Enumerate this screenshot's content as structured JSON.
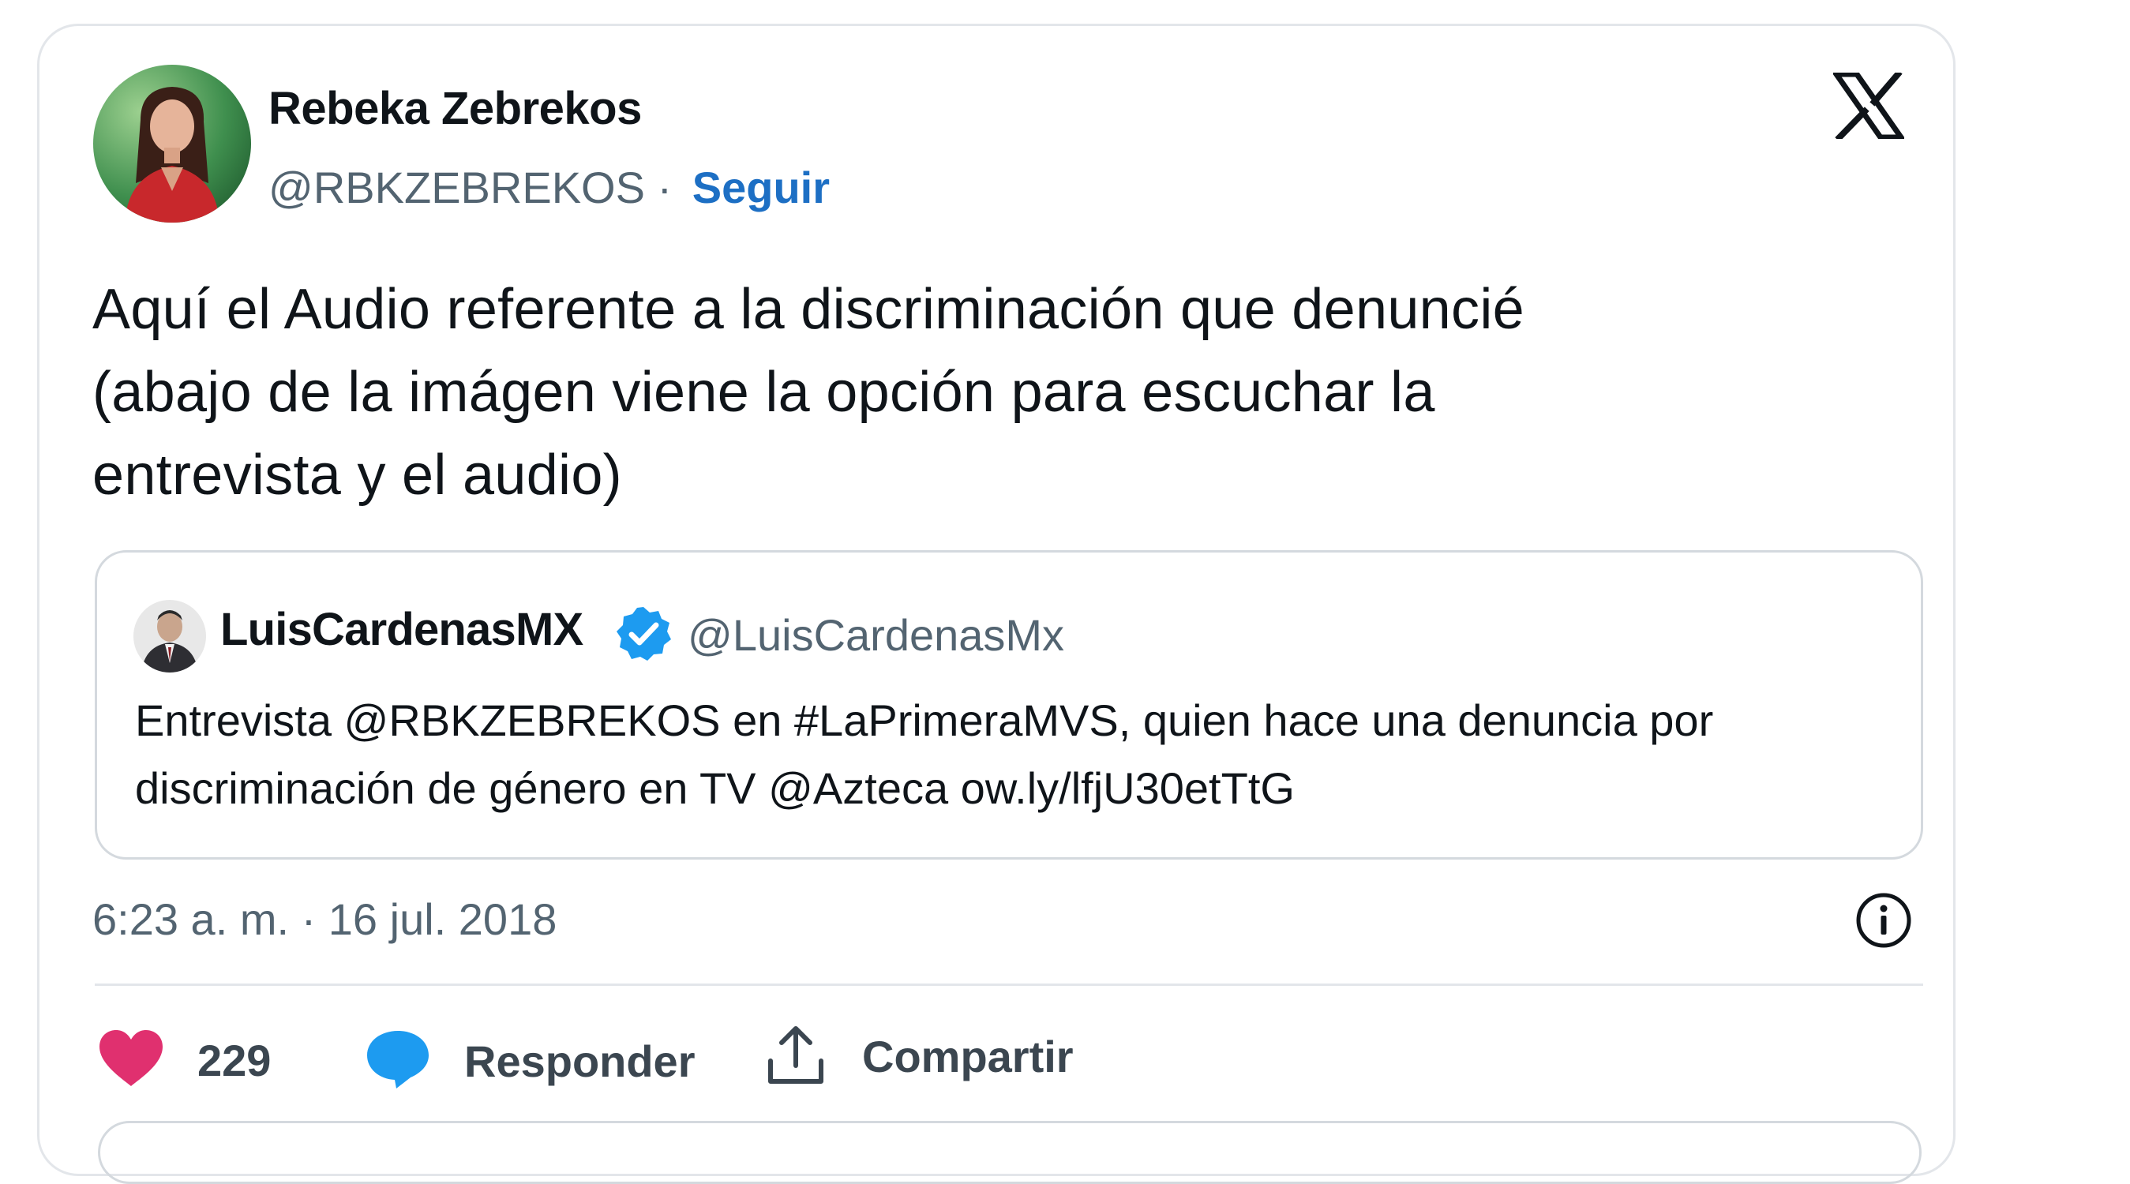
{
  "author": {
    "name": "Rebeka Zebrekos",
    "handle": "@RBKZEBREKOS",
    "separator": " · ",
    "follow_label": "Seguir"
  },
  "brand_icon": "x-logo-icon",
  "tweet": {
    "lines": [
      "Aquí el Audio referente a la discriminación que denuncié",
      "(abajo de la imágen viene la opción para escuchar la",
      "entrevista y el audio)"
    ]
  },
  "quoted": {
    "name": "LuisCardenasMX",
    "verified": true,
    "handle": "@LuisCardenasMx",
    "lines": [
      "Entrevista @RBKZEBREKOS  en #LaPrimeraMVS, quien hace una denuncia por",
      "discriminación de género en TV @Azteca  ow.ly/lfjU30etTtG"
    ]
  },
  "timestamp": "6:23 a. m. · 16 jul. 2018",
  "actions": {
    "like_count": "229",
    "reply_label": "Responder",
    "share_label": "Compartir"
  },
  "colors": {
    "link_blue": "#1d6fc4",
    "verified_blue": "#1d9bf0",
    "heart_pink": "#e0306f",
    "reply_blue": "#1d9bf0",
    "text_dark": "#0f1419",
    "text_gray": "#536471",
    "border": "#e3e6ea"
  }
}
